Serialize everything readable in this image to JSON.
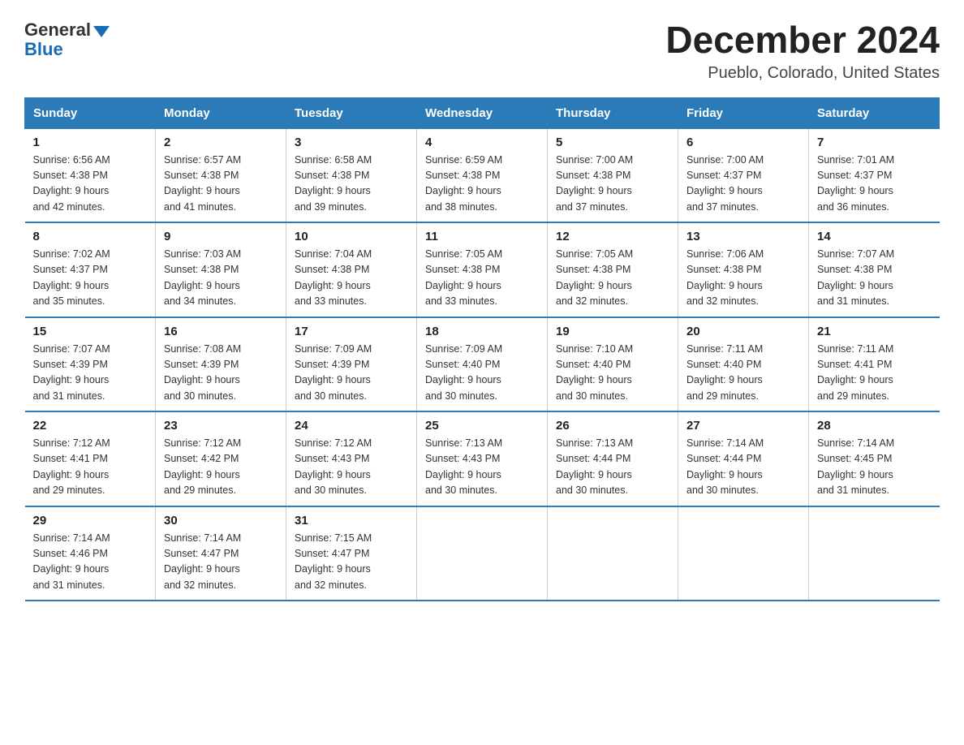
{
  "header": {
    "logo_general": "General",
    "logo_blue": "Blue",
    "month_title": "December 2024",
    "location": "Pueblo, Colorado, United States"
  },
  "days_of_week": [
    "Sunday",
    "Monday",
    "Tuesday",
    "Wednesday",
    "Thursday",
    "Friday",
    "Saturday"
  ],
  "weeks": [
    [
      {
        "day": "1",
        "sunrise": "6:56 AM",
        "sunset": "4:38 PM",
        "daylight": "9 hours and 42 minutes."
      },
      {
        "day": "2",
        "sunrise": "6:57 AM",
        "sunset": "4:38 PM",
        "daylight": "9 hours and 41 minutes."
      },
      {
        "day": "3",
        "sunrise": "6:58 AM",
        "sunset": "4:38 PM",
        "daylight": "9 hours and 39 minutes."
      },
      {
        "day": "4",
        "sunrise": "6:59 AM",
        "sunset": "4:38 PM",
        "daylight": "9 hours and 38 minutes."
      },
      {
        "day": "5",
        "sunrise": "7:00 AM",
        "sunset": "4:38 PM",
        "daylight": "9 hours and 37 minutes."
      },
      {
        "day": "6",
        "sunrise": "7:00 AM",
        "sunset": "4:37 PM",
        "daylight": "9 hours and 37 minutes."
      },
      {
        "day": "7",
        "sunrise": "7:01 AM",
        "sunset": "4:37 PM",
        "daylight": "9 hours and 36 minutes."
      }
    ],
    [
      {
        "day": "8",
        "sunrise": "7:02 AM",
        "sunset": "4:37 PM",
        "daylight": "9 hours and 35 minutes."
      },
      {
        "day": "9",
        "sunrise": "7:03 AM",
        "sunset": "4:38 PM",
        "daylight": "9 hours and 34 minutes."
      },
      {
        "day": "10",
        "sunrise": "7:04 AM",
        "sunset": "4:38 PM",
        "daylight": "9 hours and 33 minutes."
      },
      {
        "day": "11",
        "sunrise": "7:05 AM",
        "sunset": "4:38 PM",
        "daylight": "9 hours and 33 minutes."
      },
      {
        "day": "12",
        "sunrise": "7:05 AM",
        "sunset": "4:38 PM",
        "daylight": "9 hours and 32 minutes."
      },
      {
        "day": "13",
        "sunrise": "7:06 AM",
        "sunset": "4:38 PM",
        "daylight": "9 hours and 32 minutes."
      },
      {
        "day": "14",
        "sunrise": "7:07 AM",
        "sunset": "4:38 PM",
        "daylight": "9 hours and 31 minutes."
      }
    ],
    [
      {
        "day": "15",
        "sunrise": "7:07 AM",
        "sunset": "4:39 PM",
        "daylight": "9 hours and 31 minutes."
      },
      {
        "day": "16",
        "sunrise": "7:08 AM",
        "sunset": "4:39 PM",
        "daylight": "9 hours and 30 minutes."
      },
      {
        "day": "17",
        "sunrise": "7:09 AM",
        "sunset": "4:39 PM",
        "daylight": "9 hours and 30 minutes."
      },
      {
        "day": "18",
        "sunrise": "7:09 AM",
        "sunset": "4:40 PM",
        "daylight": "9 hours and 30 minutes."
      },
      {
        "day": "19",
        "sunrise": "7:10 AM",
        "sunset": "4:40 PM",
        "daylight": "9 hours and 30 minutes."
      },
      {
        "day": "20",
        "sunrise": "7:11 AM",
        "sunset": "4:40 PM",
        "daylight": "9 hours and 29 minutes."
      },
      {
        "day": "21",
        "sunrise": "7:11 AM",
        "sunset": "4:41 PM",
        "daylight": "9 hours and 29 minutes."
      }
    ],
    [
      {
        "day": "22",
        "sunrise": "7:12 AM",
        "sunset": "4:41 PM",
        "daylight": "9 hours and 29 minutes."
      },
      {
        "day": "23",
        "sunrise": "7:12 AM",
        "sunset": "4:42 PM",
        "daylight": "9 hours and 29 minutes."
      },
      {
        "day": "24",
        "sunrise": "7:12 AM",
        "sunset": "4:43 PM",
        "daylight": "9 hours and 30 minutes."
      },
      {
        "day": "25",
        "sunrise": "7:13 AM",
        "sunset": "4:43 PM",
        "daylight": "9 hours and 30 minutes."
      },
      {
        "day": "26",
        "sunrise": "7:13 AM",
        "sunset": "4:44 PM",
        "daylight": "9 hours and 30 minutes."
      },
      {
        "day": "27",
        "sunrise": "7:14 AM",
        "sunset": "4:44 PM",
        "daylight": "9 hours and 30 minutes."
      },
      {
        "day": "28",
        "sunrise": "7:14 AM",
        "sunset": "4:45 PM",
        "daylight": "9 hours and 31 minutes."
      }
    ],
    [
      {
        "day": "29",
        "sunrise": "7:14 AM",
        "sunset": "4:46 PM",
        "daylight": "9 hours and 31 minutes."
      },
      {
        "day": "30",
        "sunrise": "7:14 AM",
        "sunset": "4:47 PM",
        "daylight": "9 hours and 32 minutes."
      },
      {
        "day": "31",
        "sunrise": "7:15 AM",
        "sunset": "4:47 PM",
        "daylight": "9 hours and 32 minutes."
      },
      null,
      null,
      null,
      null
    ]
  ],
  "labels": {
    "sunrise": "Sunrise:",
    "sunset": "Sunset:",
    "daylight": "Daylight:"
  }
}
